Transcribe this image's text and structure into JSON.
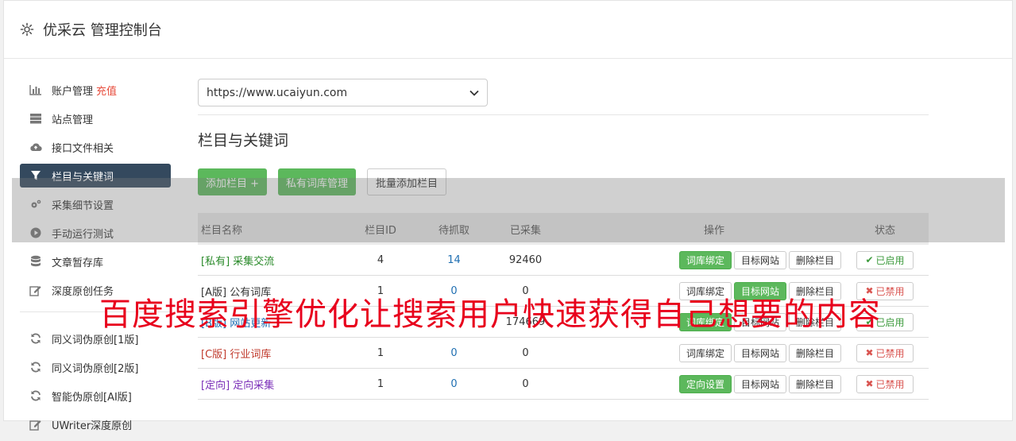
{
  "header": {
    "title": "优采云 管理控制台",
    "icon": "gear-icon"
  },
  "sidebar": {
    "items": [
      {
        "label": "账户管理",
        "extra": "充值",
        "icon": "bar-chart-icon"
      },
      {
        "label": "站点管理",
        "icon": "server-icon"
      },
      {
        "label": "接口文件相关",
        "icon": "cloud-upload-icon"
      },
      {
        "label": "栏目与关键词",
        "icon": "filter-icon",
        "active": true
      },
      {
        "label": "采集细节设置",
        "icon": "cogs-icon"
      },
      {
        "label": "手动运行测试",
        "icon": "play-icon"
      },
      {
        "label": "文章暂存库",
        "icon": "database-icon"
      },
      {
        "label": "深度原创任务",
        "icon": "edit-icon"
      },
      {
        "label": "同义词伪原创[1版]",
        "icon": "refresh-icon"
      },
      {
        "label": "同义词伪原创[2版]",
        "icon": "refresh-icon"
      },
      {
        "label": "智能伪原创[AI版]",
        "icon": "refresh-icon"
      },
      {
        "label": "UWriter深度原创",
        "icon": "edit-icon"
      }
    ]
  },
  "main": {
    "site_select": {
      "value": "https://www.ucaiyun.com"
    },
    "section_title": "栏目与关键词",
    "buttons": {
      "add": "添加栏目 +",
      "private_lib": "私有词库管理",
      "batch_add": "批量添加栏目"
    },
    "table": {
      "headers": {
        "name": "栏目名称",
        "id": "栏目ID",
        "pending": "待抓取",
        "collected": "已采集",
        "ops": "操作",
        "status": "状态"
      },
      "rows": [
        {
          "tag": "[私有]",
          "name": "采集交流",
          "id": "4",
          "pending": "14",
          "collected": "92460",
          "op1": "词库绑定",
          "op2": "目标网站",
          "op3": "删除栏目",
          "status": "已启用"
        },
        {
          "tag": "[A版]",
          "name": "公有词库",
          "id": "1",
          "pending": "0",
          "collected": "0",
          "op1": "词库绑定",
          "op2": "目标网站",
          "op3": "删除栏目",
          "status": "已禁用"
        },
        {
          "tag": "[B版]",
          "name": "网站更新",
          "id": "",
          "pending": "",
          "collected": "174669",
          "op1": "词库绑定",
          "op2": "目标网站",
          "op3": "删除栏目",
          "status": "已启用"
        },
        {
          "tag": "[C版]",
          "name": "行业词库",
          "id": "1",
          "pending": "0",
          "collected": "0",
          "op1": "词库绑定",
          "op2": "目标网站",
          "op3": "删除栏目",
          "status": "已禁用"
        },
        {
          "tag": "[定向]",
          "name": "定向采集",
          "id": "1",
          "pending": "0",
          "collected": "0",
          "op1": "定向设置",
          "op2": "目标网站",
          "op3": "删除栏目",
          "status": "已禁用"
        }
      ]
    }
  },
  "watermark": "百度搜索引擎优化让搜索用户快速获得自己想要的内容",
  "colors": {
    "accent_green": "#5cb85c",
    "active_nav": "#34495e",
    "danger": "#d9534f",
    "watermark": "#e8001c"
  }
}
